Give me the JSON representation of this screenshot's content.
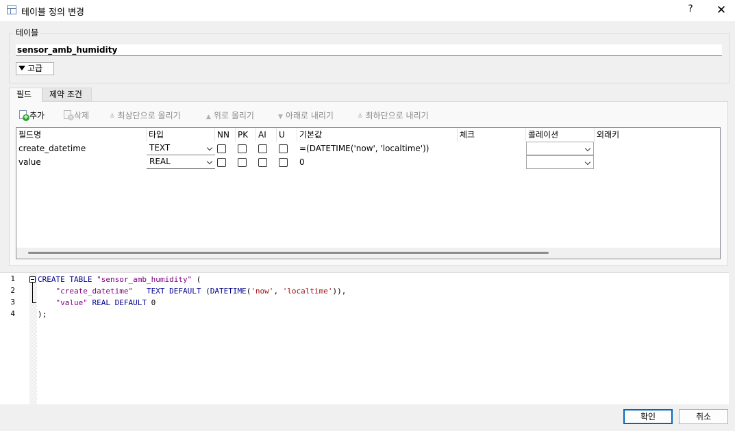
{
  "window": {
    "title": "테이블 정의 변경",
    "help": "?",
    "close": "✕"
  },
  "table_group": {
    "label": "테이블",
    "name": "sensor_amb_humidity",
    "advanced_label": "고급"
  },
  "tabs": [
    {
      "label": "필드"
    },
    {
      "label": "제약 조건"
    }
  ],
  "toolbar": {
    "add": "추가",
    "delete": "삭제",
    "move_top": "최상단으로 올리기",
    "move_up": "위로 올리기",
    "move_down": "아래로 내리기",
    "move_bottom": "최하단으로 내리기"
  },
  "grid": {
    "columns": [
      "필드명",
      "타입",
      "NN",
      "PK",
      "AI",
      "U",
      "기본값",
      "체크",
      "콜레이션",
      "외래키"
    ],
    "rows": [
      {
        "name": "create_datetime",
        "type": "TEXT",
        "nn": false,
        "pk": false,
        "ai": false,
        "u": false,
        "default": "=(DATETIME('now', 'localtime'))",
        "check": "",
        "collation": "",
        "fk": ""
      },
      {
        "name": "value",
        "type": "REAL",
        "nn": false,
        "pk": false,
        "ai": false,
        "u": false,
        "default": "0",
        "check": "",
        "collation": "",
        "fk": ""
      }
    ]
  },
  "sql": {
    "line_numbers": [
      "1",
      "2",
      "3",
      "4"
    ],
    "l1_kw": "CREATE TABLE",
    "l1_name": "\"sensor_amb_humidity\"",
    "l1_paren": " (",
    "l2_col": "\"create_datetime\"",
    "l2_type": "TEXT DEFAULT",
    "l2_fn": "DATETIME",
    "l2_arg1": "'now'",
    "l2_arg2": "'localtime'",
    "l2_tail": ")),",
    "l3_col": "\"value\"",
    "l3_type": "REAL DEFAULT",
    "l3_val": " 0",
    "l4": ");"
  },
  "buttons": {
    "ok": "확인",
    "cancel": "취소"
  },
  "colors": {
    "keyword": "#00008b",
    "identifier": "#800080",
    "string": "#a01010",
    "ok_border": "#0067c0"
  }
}
